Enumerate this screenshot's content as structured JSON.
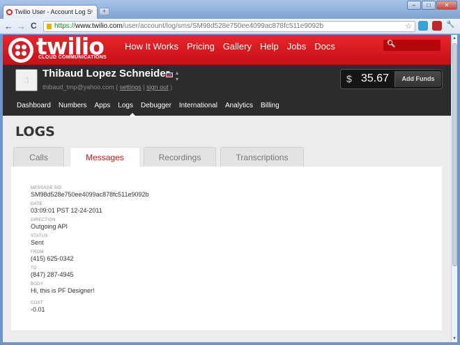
{
  "browser": {
    "tab_title": "Twilio User - Account Log S",
    "tab_close": "×",
    "new_tab": "+",
    "url_scheme": "https://",
    "url_host": "www.twilio.com",
    "url_path": "/user/account/log/sms/SM98d528e750ee4099ac878fc511e9092b",
    "back": "←",
    "forward": "→",
    "reload": "C",
    "bookmark": "☆",
    "wrench": "🔧",
    "minimize": "–",
    "maximize": "□",
    "close": "✕"
  },
  "brand": {
    "logo_text": "twilio",
    "logo_subtitle": "CLOUD COMMUNICATIONS"
  },
  "main_nav": [
    "How It Works",
    "Pricing",
    "Gallery",
    "Help",
    "Jobs",
    "Docs"
  ],
  "search_icon_glyph": "🔍︎",
  "account": {
    "avatar_text": ":)",
    "name": "Thibaud Lopez Schneider",
    "email": "thibaud_tmp@yahoo.com",
    "settings_link": "settings",
    "signout_link": "sign out",
    "currency": "$",
    "balance": "35.67",
    "add_funds": "Add Funds"
  },
  "sub_nav": [
    "Dashboard",
    "Numbers",
    "Apps",
    "Logs",
    "Debugger",
    "International",
    "Analytics",
    "Billing"
  ],
  "page_title": "LOGS",
  "log_tabs": [
    "Calls",
    "Messages",
    "Recordings",
    "Transcriptions"
  ],
  "message": {
    "fields": [
      {
        "label": "MESSAGE SID",
        "value": "SM98d528e750ee4099ac878fc511e9092b"
      },
      {
        "label": "DATE",
        "value": "03:09:01 PST 12-24-2011"
      },
      {
        "label": "DIRECTION",
        "value": "Outgoing API"
      },
      {
        "label": "STATUS",
        "value": "Sent"
      },
      {
        "label": "FROM",
        "value": "(415) 625-0342"
      },
      {
        "label": "TO",
        "value": "(847) 287-4945"
      },
      {
        "label": "BODY",
        "value": "Hi, this is PF Designer!"
      },
      {
        "label": "COST",
        "value": "-0.01"
      }
    ]
  }
}
